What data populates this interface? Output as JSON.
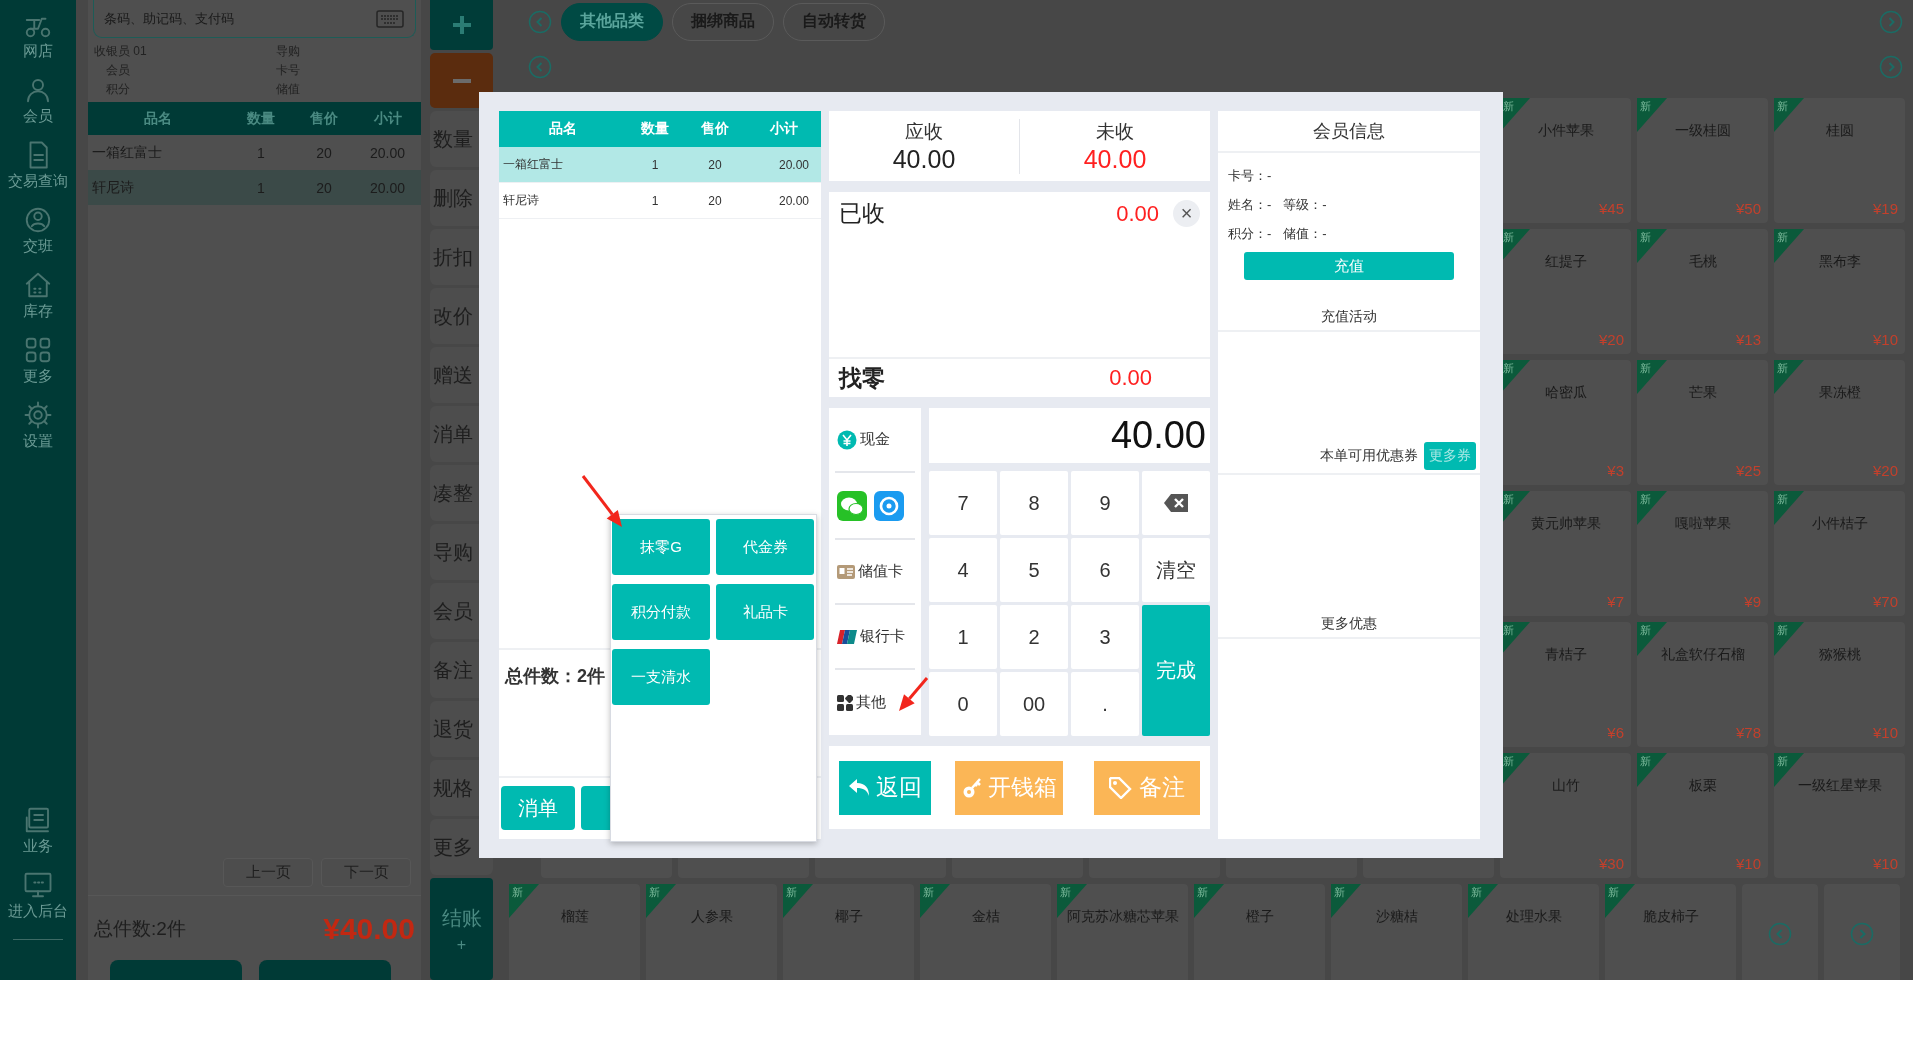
{
  "sidebar": {
    "items": [
      {
        "label": "网店"
      },
      {
        "label": "会员"
      },
      {
        "label": "交易查询"
      },
      {
        "label": "交班"
      },
      {
        "label": "库存"
      },
      {
        "label": "更多"
      },
      {
        "label": "设置"
      }
    ],
    "bottom_items": [
      {
        "label": "业务"
      },
      {
        "label": "进入后台"
      }
    ]
  },
  "cart": {
    "search": {
      "placeholder": "条码、助记码、支付码"
    },
    "info": [
      {
        "label": "收银员",
        "value": "01"
      },
      {
        "label": "导购"
      },
      {
        "label": "会员"
      },
      {
        "label": "卡号"
      },
      {
        "label": "积分"
      },
      {
        "label": "储值"
      }
    ],
    "columns": [
      "品名",
      "数量",
      "售价",
      "小计"
    ],
    "rows": [
      {
        "cells": [
          "一箱红富士",
          "1",
          "20",
          "20.00"
        ],
        "selected": false
      },
      {
        "cells": [
          "轩尼诗",
          "1",
          "20",
          "20.00"
        ],
        "selected": true
      }
    ],
    "pager": [
      "上一页",
      "下一页"
    ],
    "total_count": "总件数:2件",
    "total_amount": "¥40.00"
  },
  "actions": {
    "buttons": [
      "数量",
      "删除",
      "折扣",
      "改价",
      "赠送",
      "消单",
      "凑整",
      "导购",
      "会员",
      "备注",
      "退货",
      "规格",
      "更多"
    ],
    "checkout": "结账",
    "checkout_mark": "+"
  },
  "catalog": {
    "tabs": [
      {
        "label": "其他品类",
        "selected": true
      },
      {
        "label": "捆绑商品",
        "selected": false
      },
      {
        "label": "自动转货",
        "selected": false
      }
    ],
    "rows": [
      [
        {
          "name": "小件苹果",
          "price": "¥45",
          "badge": "新"
        },
        {
          "name": "一级桂圆",
          "price": "¥50",
          "badge": "新"
        },
        {
          "name": "桂圆",
          "price": "¥19",
          "badge": "新"
        }
      ],
      [
        {
          "name": "红提子",
          "price": "¥20",
          "badge": "新"
        },
        {
          "name": "毛桃",
          "price": "¥13",
          "badge": "新"
        },
        {
          "name": "黑布李",
          "price": "¥10",
          "badge": "新"
        }
      ],
      [
        {
          "name": "哈密瓜",
          "price": "¥3",
          "badge": "新"
        },
        {
          "name": "芒果",
          "price": "¥25",
          "badge": "新"
        },
        {
          "name": "果冻橙",
          "price": "¥20",
          "badge": "新"
        }
      ],
      [
        {
          "name": "黄元帅苹果",
          "price": "¥7",
          "badge": "新"
        },
        {
          "name": "嘎啦苹果",
          "price": "¥9",
          "badge": "新"
        },
        {
          "name": "小件桔子",
          "price": "¥70",
          "badge": "新"
        }
      ],
      [
        {
          "name": "青桔子",
          "price": "¥6",
          "badge": "新"
        },
        {
          "name": "礼盒软仔石榴",
          "price": "¥78",
          "badge": "新"
        },
        {
          "name": "猕猴桃",
          "price": "¥10",
          "badge": "新"
        }
      ],
      [
        {
          "name": "山竹",
          "price": "¥30",
          "badge": "新"
        },
        {
          "name": "板栗",
          "price": "¥10",
          "badge": "新"
        },
        {
          "name": "一级红星苹果",
          "price": "¥10",
          "badge": "新"
        }
      ]
    ],
    "bottom_row": [
      {
        "name": "榴莲",
        "badge": "新"
      },
      {
        "name": "人参果",
        "badge": "新"
      },
      {
        "name": "椰子",
        "badge": "新"
      },
      {
        "name": "金桔",
        "badge": "新"
      },
      {
        "name": "阿克苏冰糖芯苹果",
        "badge": "新"
      },
      {
        "name": "橙子",
        "badge": "新"
      },
      {
        "name": "沙糖桔",
        "badge": "新"
      },
      {
        "name": "处理水果",
        "badge": "新"
      },
      {
        "name": "脆皮柿子",
        "badge": "新"
      }
    ]
  },
  "payment": {
    "order": {
      "columns": [
        "品名",
        "数量",
        "售价",
        "小计"
      ],
      "rows": [
        {
          "cells": [
            "一箱红富士",
            "1",
            "20",
            "20.00"
          ],
          "selected": true
        },
        {
          "cells": [
            "轩尼诗",
            "1",
            "20",
            "20.00"
          ],
          "selected": false
        }
      ],
      "total_count": "总件数：2件",
      "cancel_button": "消单"
    },
    "popup": {
      "options": [
        "抹零G",
        "代金券",
        "积分付款",
        "礼品卡",
        "一支清水"
      ]
    },
    "summary": [
      {
        "kind": "due",
        "label": "应收",
        "value": "40.00"
      },
      {
        "kind": "unpaid",
        "label": "未收",
        "value": "40.00"
      }
    ],
    "received": {
      "label": "已收",
      "value": "0.00",
      "clear": "×"
    },
    "change": {
      "label": "找零",
      "value": "0.00"
    },
    "methods": [
      {
        "kind": "cash",
        "label": "现金"
      },
      {
        "kind": "apps"
      },
      {
        "kind": "stored_card",
        "label": "储值卡"
      },
      {
        "kind": "bank_card",
        "label": "银行卡"
      },
      {
        "kind": "other",
        "label": "其他"
      }
    ],
    "amount": "40.00",
    "keys": [
      {
        "kind": "digit",
        "label": "7"
      },
      {
        "kind": "digit",
        "label": "8"
      },
      {
        "kind": "digit",
        "label": "9"
      },
      {
        "kind": "backspace"
      },
      {
        "kind": "digit",
        "label": "4"
      },
      {
        "kind": "digit",
        "label": "5"
      },
      {
        "kind": "digit",
        "label": "6"
      },
      {
        "kind": "clear",
        "label": "清空"
      },
      {
        "kind": "digit",
        "label": "1"
      },
      {
        "kind": "digit",
        "label": "2"
      },
      {
        "kind": "digit",
        "label": "3"
      },
      {
        "kind": "done",
        "label": "完成"
      },
      {
        "kind": "digit",
        "label": "0"
      },
      {
        "kind": "digit",
        "label": "00"
      },
      {
        "kind": "digit",
        "label": "."
      }
    ],
    "bottom_buttons": [
      {
        "kind": "back",
        "label": "返回"
      },
      {
        "kind": "cash_drawer",
        "label": "开钱箱"
      },
      {
        "kind": "note",
        "label": "备注"
      }
    ],
    "member": {
      "title": "会员信息",
      "fields": [
        [
          "卡号：-"
        ],
        [
          "姓名：-",
          "等级：-"
        ],
        [
          "积分：-",
          "储值：-"
        ]
      ],
      "recharge": "充值",
      "recharge_title": "充值活动",
      "coupon_label": "本单可用优惠券",
      "coupon_button": "更多券",
      "more_title": "更多优惠"
    }
  }
}
